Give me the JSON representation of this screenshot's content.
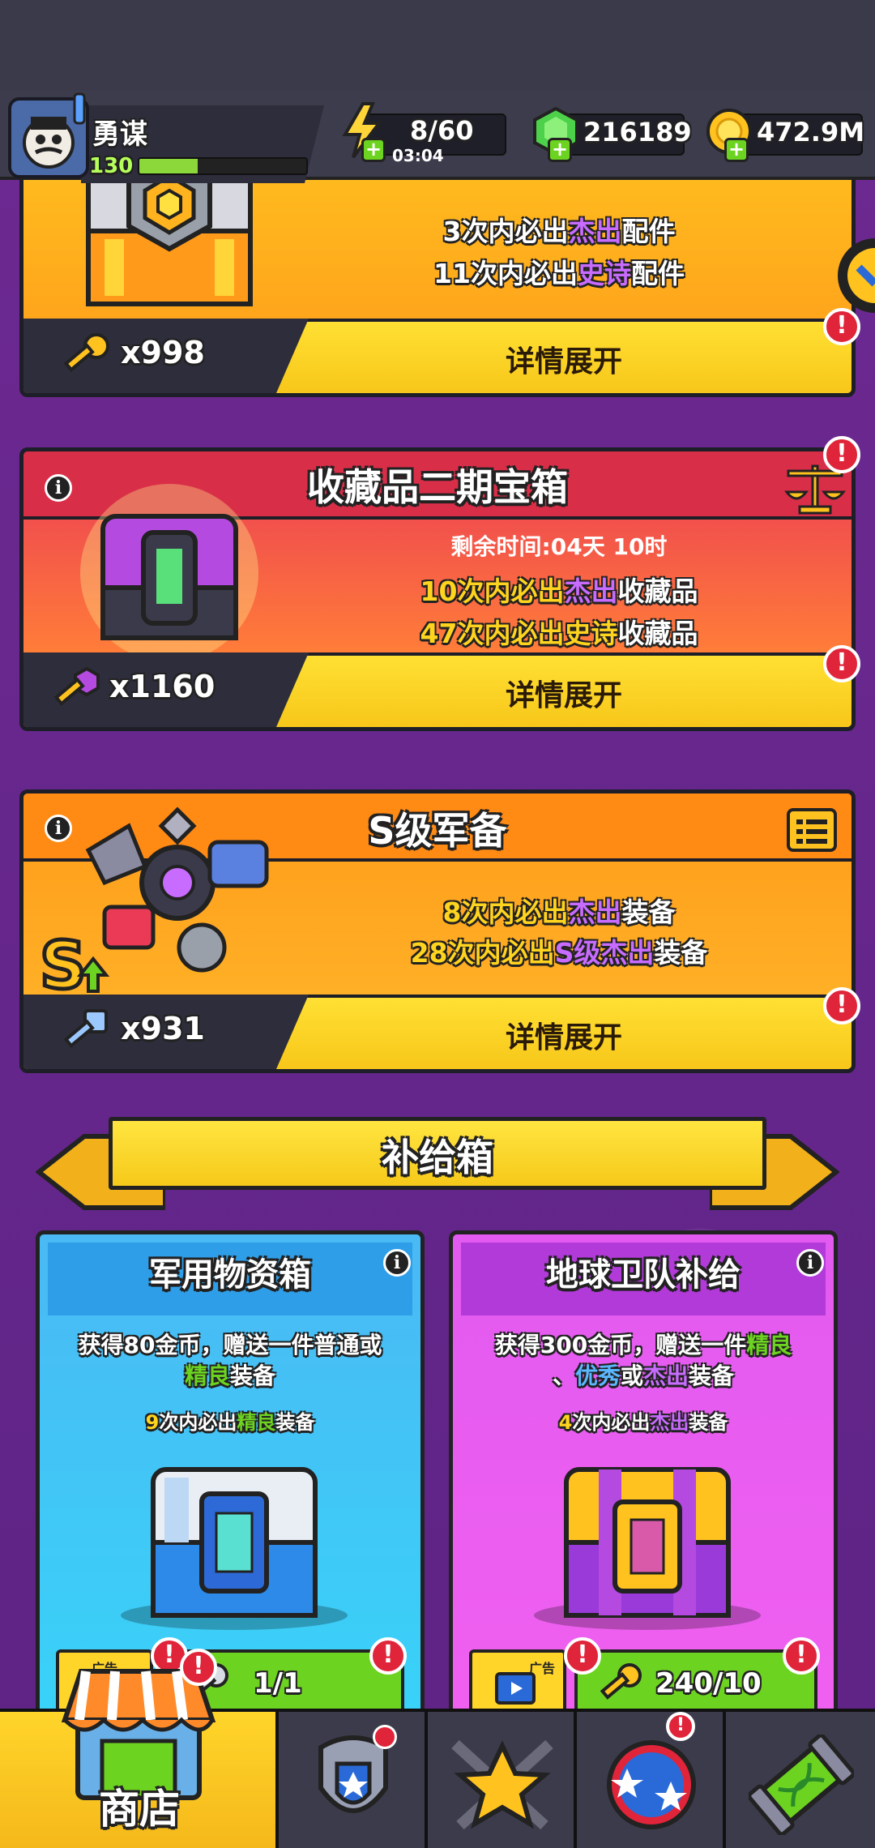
{
  "header": {
    "player_name": "勇谋",
    "player_level": "130",
    "level_progress": 0.35,
    "energy": "8/60",
    "energy_timer": "03:04",
    "gems": "216189",
    "gold": "472.9M"
  },
  "chest_1": {
    "line1_prefix": "3次内必出",
    "line1_hl": "杰出",
    "line1_suffix": "配件",
    "line2_prefix": "11次内必出",
    "line2_hl": "史诗",
    "line2_suffix": "配件",
    "key_count": "x998",
    "detail_label": "详情展开"
  },
  "chest_2": {
    "title": "收藏品二期宝箱",
    "time_left": "剩余时间:04天 10时",
    "line1_prefix": "10次内必出",
    "line1_hl": "杰出",
    "line1_suffix": "收藏品",
    "line2_prefix": "47次内必出",
    "line2_hl": "史诗",
    "line2_suffix": "收藏品",
    "key_count": "x1160",
    "detail_label": "详情展开"
  },
  "chest_3": {
    "title": "S级军备",
    "line1_prefix": "8次内必出",
    "line1_hl": "杰出",
    "line1_suffix": "装备",
    "line2_prefix": "28次内必出",
    "line2_hl": "S级杰出",
    "line2_suffix": "装备",
    "key_count": "x931",
    "detail_label": "详情展开"
  },
  "supply_section": {
    "title": "补给箱"
  },
  "supply_left": {
    "title": "军用物资箱",
    "desc_1": "获得80金币，赠送一件普通或",
    "desc_2_hl": "精良",
    "desc_2_suffix": "装备",
    "chance_num": "9",
    "chance_mid": "次内必出",
    "chance_hl": "精良",
    "chance_suffix": "装备",
    "ad_label": "广告",
    "key_count": "1/1"
  },
  "supply_right": {
    "title": "地球卫队补给",
    "desc_1_prefix": "获得300金币，赠送一件",
    "desc_1_hl": "精良",
    "desc_2_prefix": "、",
    "desc_2_hl1": "优秀",
    "desc_2_mid": "或",
    "desc_2_hl2": "杰出",
    "desc_2_suffix": "装备",
    "chance_num": "4",
    "chance_mid": "次内必出",
    "chance_hl": "杰出",
    "chance_suffix": "装备",
    "ad_label": "广告",
    "key_count": "240/10"
  },
  "nav": {
    "shop_label": "商店"
  },
  "badges": {
    "exclaim": "!"
  },
  "colors": {
    "background": "#6a2a8c",
    "accent_yellow": "#f7c71a",
    "badge_red": "#e0243a",
    "rarity_purple": "#c86cff",
    "rarity_green": "#6dd321"
  }
}
